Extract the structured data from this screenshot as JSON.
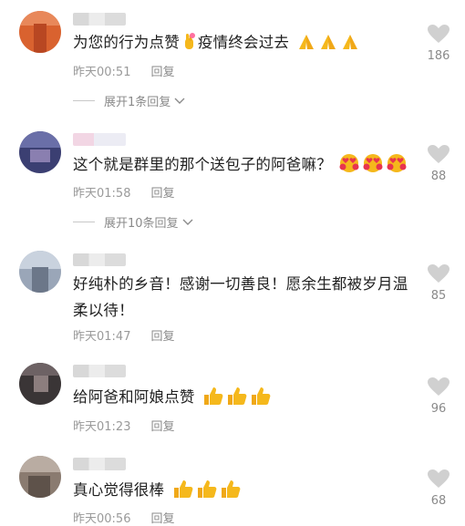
{
  "comments": [
    {
      "text": "为您的行为点赞",
      "text2": "疫情终会过去",
      "time": "昨天00:51",
      "reply": "回复",
      "likes": "186",
      "expand": "展开1条回复"
    },
    {
      "text": "这个就是群里的那个送包子的阿爸嘛？",
      "time": "昨天01:58",
      "reply": "回复",
      "likes": "88",
      "expand": "展开10条回复"
    },
    {
      "text": "好纯朴的乡音！感谢一切善良！愿余生都被岁月温柔以待！",
      "time": "昨天01:47",
      "reply": "回复",
      "likes": "85"
    },
    {
      "text": "给阿爸和阿娘点赞",
      "time": "昨天01:23",
      "reply": "回复",
      "likes": "96"
    },
    {
      "text": "真心觉得很棒",
      "time": "昨天00:56",
      "reply": "回复",
      "likes": "68"
    }
  ],
  "icons": {
    "like": "heart-icon",
    "expand": "chevron-down-icon",
    "emoji_pray": "folded-hands-emoji",
    "emoji_bless": "smiling-hearts-emoji",
    "emoji_thumb": "thumbs-up-emoji",
    "emoji_cross": "crossed-fingers-emoji"
  },
  "colors": {
    "meta": "#9a9a9a",
    "heart": "#d0d0d0",
    "emoji_yellow": "#f5b81c"
  }
}
